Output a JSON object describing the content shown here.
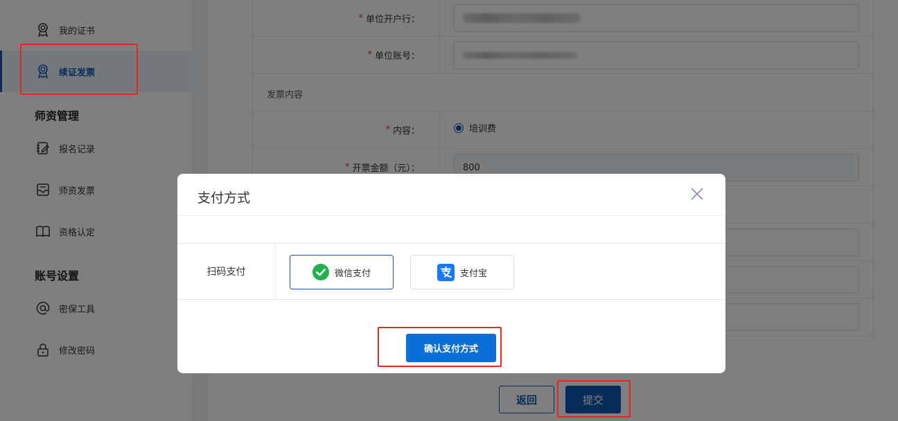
{
  "sidebar": {
    "items": [
      {
        "label": "我的证书",
        "icon": "certificate-icon"
      },
      {
        "label": "续证发票",
        "icon": "certificate-icon",
        "active": true
      },
      {
        "label": "报名记录",
        "icon": "edit-note-icon"
      },
      {
        "label": "师资发票",
        "icon": "inbox-icon"
      },
      {
        "label": "资格认定",
        "icon": "book-icon"
      },
      {
        "label": "密保工具",
        "icon": "at-sign-icon"
      },
      {
        "label": "修改密码",
        "icon": "lock-icon"
      }
    ],
    "sections": {
      "teacher": "师资管理",
      "account": "账号设置"
    }
  },
  "form": {
    "bank_label": "单位开户行：",
    "account_label": "单位账号：",
    "invoice_section": "发票内容",
    "content_label": "内容：",
    "content_option": "培训费",
    "amount_label": "开票金额（元）：",
    "amount_value": "800",
    "required_mark": "*"
  },
  "buttons": {
    "back": "返回",
    "submit": "提交"
  },
  "modal": {
    "title": "支付方式",
    "pay_label": "扫码支付",
    "options": [
      {
        "label": "微信支付",
        "icon": "wechat-pay-icon",
        "selected": true
      },
      {
        "label": "支付宝",
        "icon": "alipay-icon",
        "selected": false
      }
    ],
    "confirm": "确认支付方式"
  },
  "colors": {
    "primary": "#1058b4",
    "confirm": "#0a6fd8",
    "wechat": "#22b14c",
    "alipay": "#1677ff",
    "highlight": "#e8281f",
    "required": "#e53935"
  }
}
